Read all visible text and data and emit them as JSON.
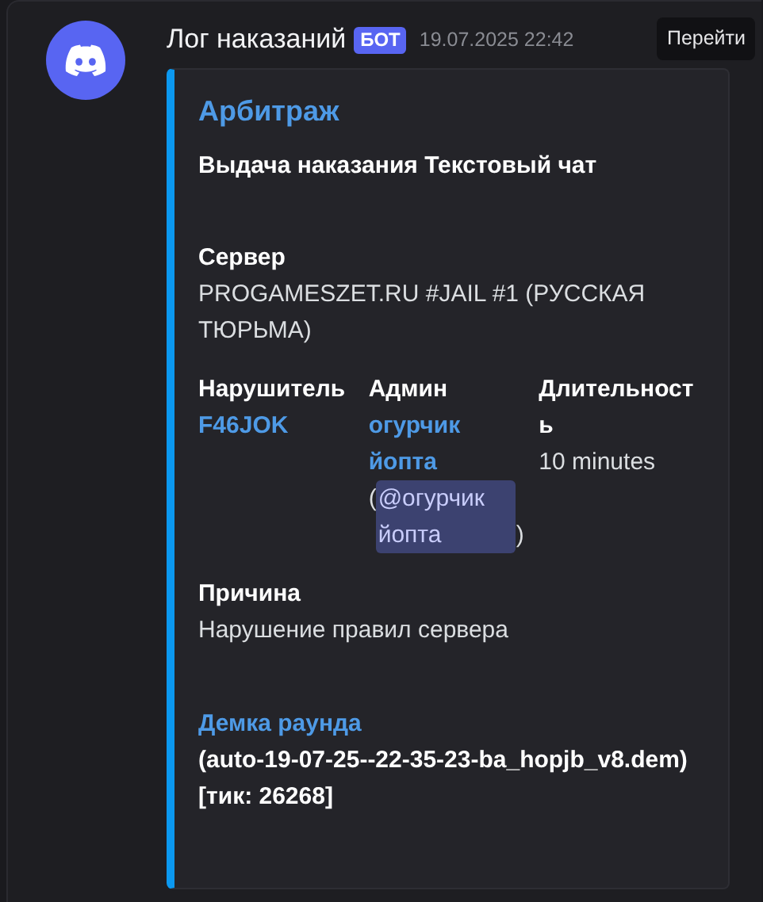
{
  "message": {
    "author": "Лог наказаний",
    "badge": "БОТ",
    "timestamp": "19.07.2025 22:42",
    "jump_button": "Перейти"
  },
  "embed": {
    "author": "Арбитраж",
    "title": "Выдача наказания Текстовый чат",
    "fields": [
      {
        "name": "Сервер",
        "name_link": false,
        "inline": false,
        "value": [
          {
            "kind": "text",
            "text": "PROGAMESZET.RU #JAIL #1 (РУССКАЯ ТЮРЬМА)"
          }
        ]
      },
      {
        "name": "Нарушитель",
        "name_link": false,
        "inline": true,
        "value": [
          {
            "kind": "link",
            "text": "F46JOK"
          }
        ]
      },
      {
        "name": "Админ",
        "name_link": false,
        "inline": true,
        "value": [
          {
            "kind": "link",
            "text": "огурчик йопта"
          },
          {
            "kind": "text",
            "text": "("
          },
          {
            "kind": "mention",
            "text": "@огурчик йопта"
          },
          {
            "kind": "text",
            "text": ")"
          }
        ]
      },
      {
        "name": "Длительность",
        "name_link": false,
        "inline": true,
        "value": [
          {
            "kind": "text",
            "text": "10 minutes"
          }
        ]
      },
      {
        "name": "Причина",
        "name_link": false,
        "inline": false,
        "value": [
          {
            "kind": "text",
            "text": "Нарушение правил сервера"
          }
        ]
      },
      {
        "name": "Демка раунда",
        "name_link": true,
        "inline": false,
        "value": [
          {
            "kind": "bold",
            "text": "(auto-19-07-25--22-35-23-ba_hopjb_v8.dem) [тик: 26268]"
          }
        ]
      }
    ]
  }
}
